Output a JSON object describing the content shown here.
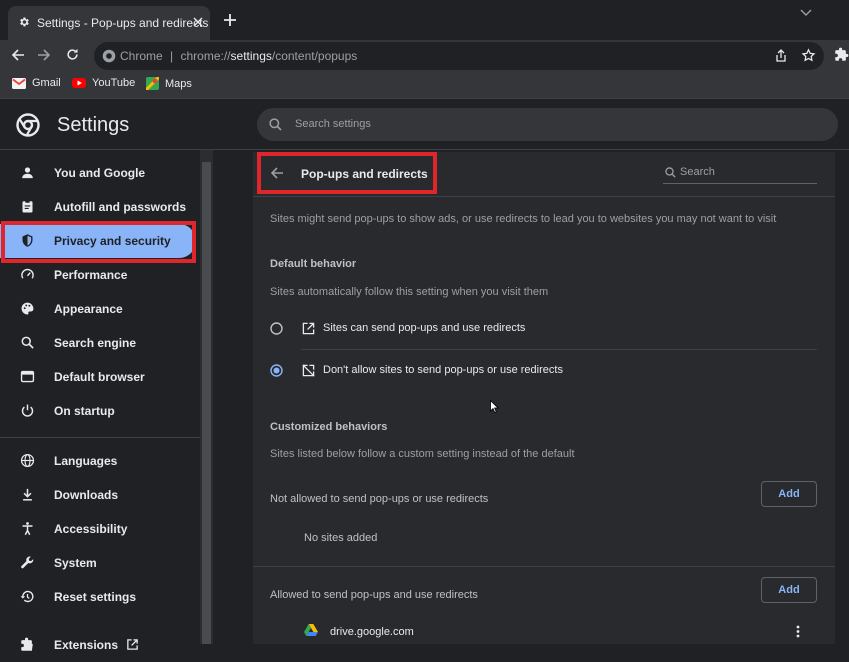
{
  "browser": {
    "tab_title": "Settings - Pop-ups and redirects",
    "new_tab_symbol": "+",
    "omnibox": {
      "site_label": "Chrome",
      "separator": "|",
      "url_prefix": "chrome://",
      "url_host": "settings",
      "url_path": "/content/popups"
    },
    "bookmarks": [
      {
        "label": "Gmail",
        "icon": "gmail-icon"
      },
      {
        "label": "YouTube",
        "icon": "youtube-icon"
      },
      {
        "label": "Maps",
        "icon": "maps-icon"
      }
    ]
  },
  "settings": {
    "title": "Settings",
    "search_placeholder": "Search settings"
  },
  "sidebar": {
    "items": [
      {
        "label": "You and Google",
        "icon": "person-icon"
      },
      {
        "label": "Autofill and passwords",
        "icon": "clipboard-icon"
      },
      {
        "label": "Privacy and security",
        "icon": "shield-icon",
        "active": true
      },
      {
        "label": "Performance",
        "icon": "speedometer-icon"
      },
      {
        "label": "Appearance",
        "icon": "palette-icon"
      },
      {
        "label": "Search engine",
        "icon": "search-icon"
      },
      {
        "label": "Default browser",
        "icon": "browser-icon"
      },
      {
        "label": "On startup",
        "icon": "power-icon"
      },
      {
        "label": "Languages",
        "icon": "globe-icon"
      },
      {
        "label": "Downloads",
        "icon": "download-icon"
      },
      {
        "label": "Accessibility",
        "icon": "accessibility-icon"
      },
      {
        "label": "System",
        "icon": "wrench-icon"
      },
      {
        "label": "Reset settings",
        "icon": "restore-icon"
      },
      {
        "label": "Extensions",
        "icon": "puzzle-icon"
      }
    ]
  },
  "page": {
    "title": "Pop-ups and redirects",
    "search_placeholder": "Search",
    "description": "Sites might send pop-ups to show ads, or use redirects to lead you to websites you may not want to visit",
    "default_behavior": {
      "heading": "Default behavior",
      "subtext": "Sites automatically follow this setting when you visit them",
      "options": [
        {
          "label": "Sites can send pop-ups and use redirects",
          "selected": false
        },
        {
          "label": "Don't allow sites to send pop-ups or use redirects",
          "selected": true
        }
      ]
    },
    "customized": {
      "heading": "Customized behaviors",
      "subtext": "Sites listed below follow a custom setting instead of the default",
      "not_allowed": {
        "label": "Not allowed to send pop-ups or use redirects",
        "button": "Add",
        "empty": "No sites added"
      },
      "allowed": {
        "label": "Allowed to send pop-ups and use redirects",
        "button": "Add",
        "sites": [
          "drive.google.com"
        ]
      }
    }
  },
  "colors": {
    "accent": "#8ab4f8",
    "highlight": "#e0262d",
    "background": "#202124",
    "card": "#292a2d"
  }
}
